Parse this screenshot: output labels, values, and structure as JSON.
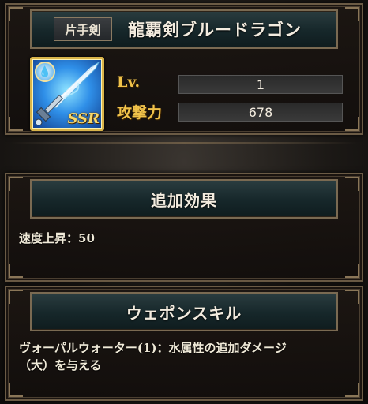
{
  "weapon": {
    "type": "片手剣",
    "name": "龍覇剣ブルードラゴン",
    "rarity": "SSR",
    "element_icon": "water-drop-icon",
    "stats": {
      "level_label": "Lv.",
      "level_value": "1",
      "attack_label": "攻撃力",
      "attack_value": "678"
    }
  },
  "effect": {
    "title": "追加効果",
    "text": "速度上昇：50"
  },
  "skill": {
    "title": "ウェポンスキル",
    "line1": "ヴォーパルウォーター(1)：水属性の追加ダメージ",
    "line2": "（大）を与える"
  },
  "colors": {
    "label_gold": "#f0c24a",
    "frame_border": "#6b5b45",
    "header_teal": "#16272a"
  }
}
